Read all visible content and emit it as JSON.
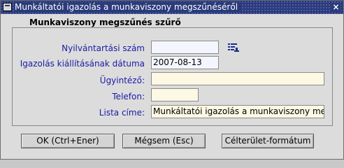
{
  "window": {
    "title": "Munkáltatói igazolás a munkaviszony megszűnéséről",
    "close_symbol": "×"
  },
  "panel": {
    "legend": "Munkaviszony megszűnés szűrő"
  },
  "fields": {
    "nyilvantartasi_szam": {
      "label": "Nyilvántartási szám",
      "value": ""
    },
    "igazolas_datum": {
      "label": "Igazolás kiállításának dátuma",
      "value": "2007-08-13"
    },
    "ugyintezo": {
      "label": "Ügyintéző:",
      "value": ""
    },
    "telefon": {
      "label": "Telefon:",
      "value": ""
    },
    "lista_cime": {
      "label": "Lista címe:",
      "value": "Munkáltatói igazolás a munkaviszony megszűnéséről"
    }
  },
  "buttons": {
    "ok": "OK (Ctrl+Ener)",
    "cancel": "Mégsem (Esc)",
    "format": "Célterület-formátum"
  },
  "colors": {
    "title_bg": "#2a3a7a",
    "label_text": "#1a1aa6",
    "required_field_bg": "#fdf8e4",
    "optional_field_bg": "#f4f6ff"
  },
  "icons": {
    "window_icon": "form-window-icon",
    "lov_button": "list-of-values-icon"
  }
}
